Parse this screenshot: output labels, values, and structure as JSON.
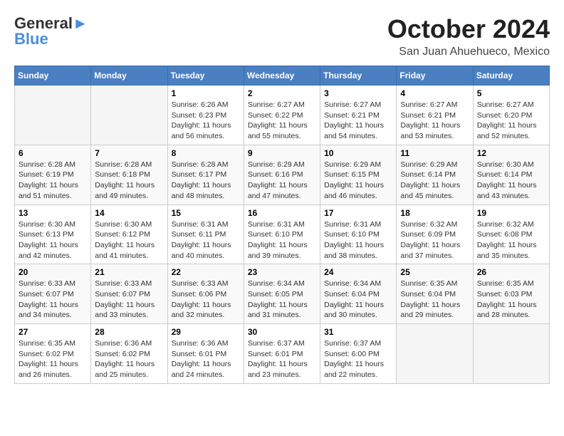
{
  "header": {
    "logo_line1": "General",
    "logo_line2": "Blue",
    "month": "October 2024",
    "location": "San Juan Ahuehueco, Mexico"
  },
  "days_of_week": [
    "Sunday",
    "Monday",
    "Tuesday",
    "Wednesday",
    "Thursday",
    "Friday",
    "Saturday"
  ],
  "weeks": [
    [
      {
        "day": "",
        "info": ""
      },
      {
        "day": "",
        "info": ""
      },
      {
        "day": "1",
        "info": "Sunrise: 6:26 AM\nSunset: 6:23 PM\nDaylight: 11 hours and 56 minutes."
      },
      {
        "day": "2",
        "info": "Sunrise: 6:27 AM\nSunset: 6:22 PM\nDaylight: 11 hours and 55 minutes."
      },
      {
        "day": "3",
        "info": "Sunrise: 6:27 AM\nSunset: 6:21 PM\nDaylight: 11 hours and 54 minutes."
      },
      {
        "day": "4",
        "info": "Sunrise: 6:27 AM\nSunset: 6:21 PM\nDaylight: 11 hours and 53 minutes."
      },
      {
        "day": "5",
        "info": "Sunrise: 6:27 AM\nSunset: 6:20 PM\nDaylight: 11 hours and 52 minutes."
      }
    ],
    [
      {
        "day": "6",
        "info": "Sunrise: 6:28 AM\nSunset: 6:19 PM\nDaylight: 11 hours and 51 minutes."
      },
      {
        "day": "7",
        "info": "Sunrise: 6:28 AM\nSunset: 6:18 PM\nDaylight: 11 hours and 49 minutes."
      },
      {
        "day": "8",
        "info": "Sunrise: 6:28 AM\nSunset: 6:17 PM\nDaylight: 11 hours and 48 minutes."
      },
      {
        "day": "9",
        "info": "Sunrise: 6:29 AM\nSunset: 6:16 PM\nDaylight: 11 hours and 47 minutes."
      },
      {
        "day": "10",
        "info": "Sunrise: 6:29 AM\nSunset: 6:15 PM\nDaylight: 11 hours and 46 minutes."
      },
      {
        "day": "11",
        "info": "Sunrise: 6:29 AM\nSunset: 6:14 PM\nDaylight: 11 hours and 45 minutes."
      },
      {
        "day": "12",
        "info": "Sunrise: 6:30 AM\nSunset: 6:14 PM\nDaylight: 11 hours and 43 minutes."
      }
    ],
    [
      {
        "day": "13",
        "info": "Sunrise: 6:30 AM\nSunset: 6:13 PM\nDaylight: 11 hours and 42 minutes."
      },
      {
        "day": "14",
        "info": "Sunrise: 6:30 AM\nSunset: 6:12 PM\nDaylight: 11 hours and 41 minutes."
      },
      {
        "day": "15",
        "info": "Sunrise: 6:31 AM\nSunset: 6:11 PM\nDaylight: 11 hours and 40 minutes."
      },
      {
        "day": "16",
        "info": "Sunrise: 6:31 AM\nSunset: 6:10 PM\nDaylight: 11 hours and 39 minutes."
      },
      {
        "day": "17",
        "info": "Sunrise: 6:31 AM\nSunset: 6:10 PM\nDaylight: 11 hours and 38 minutes."
      },
      {
        "day": "18",
        "info": "Sunrise: 6:32 AM\nSunset: 6:09 PM\nDaylight: 11 hours and 37 minutes."
      },
      {
        "day": "19",
        "info": "Sunrise: 6:32 AM\nSunset: 6:08 PM\nDaylight: 11 hours and 35 minutes."
      }
    ],
    [
      {
        "day": "20",
        "info": "Sunrise: 6:33 AM\nSunset: 6:07 PM\nDaylight: 11 hours and 34 minutes."
      },
      {
        "day": "21",
        "info": "Sunrise: 6:33 AM\nSunset: 6:07 PM\nDaylight: 11 hours and 33 minutes."
      },
      {
        "day": "22",
        "info": "Sunrise: 6:33 AM\nSunset: 6:06 PM\nDaylight: 11 hours and 32 minutes."
      },
      {
        "day": "23",
        "info": "Sunrise: 6:34 AM\nSunset: 6:05 PM\nDaylight: 11 hours and 31 minutes."
      },
      {
        "day": "24",
        "info": "Sunrise: 6:34 AM\nSunset: 6:04 PM\nDaylight: 11 hours and 30 minutes."
      },
      {
        "day": "25",
        "info": "Sunrise: 6:35 AM\nSunset: 6:04 PM\nDaylight: 11 hours and 29 minutes."
      },
      {
        "day": "26",
        "info": "Sunrise: 6:35 AM\nSunset: 6:03 PM\nDaylight: 11 hours and 28 minutes."
      }
    ],
    [
      {
        "day": "27",
        "info": "Sunrise: 6:35 AM\nSunset: 6:02 PM\nDaylight: 11 hours and 26 minutes."
      },
      {
        "day": "28",
        "info": "Sunrise: 6:36 AM\nSunset: 6:02 PM\nDaylight: 11 hours and 25 minutes."
      },
      {
        "day": "29",
        "info": "Sunrise: 6:36 AM\nSunset: 6:01 PM\nDaylight: 11 hours and 24 minutes."
      },
      {
        "day": "30",
        "info": "Sunrise: 6:37 AM\nSunset: 6:01 PM\nDaylight: 11 hours and 23 minutes."
      },
      {
        "day": "31",
        "info": "Sunrise: 6:37 AM\nSunset: 6:00 PM\nDaylight: 11 hours and 22 minutes."
      },
      {
        "day": "",
        "info": ""
      },
      {
        "day": "",
        "info": ""
      }
    ]
  ]
}
